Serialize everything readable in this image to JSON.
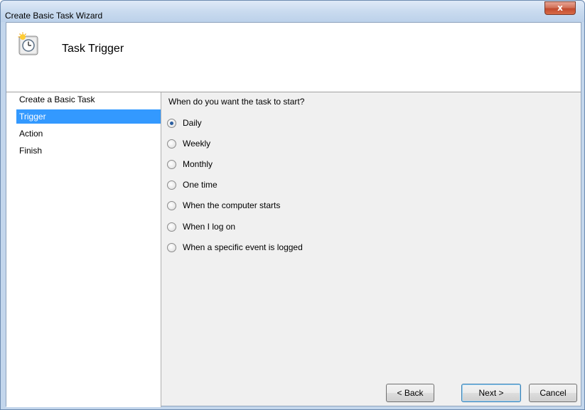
{
  "window": {
    "title": "Create Basic Task Wizard",
    "close_glyph": "x"
  },
  "header": {
    "title": "Task Trigger",
    "icon": "task-scheduler-clock-icon"
  },
  "nav": {
    "items": [
      {
        "label": "Create a Basic Task",
        "selected": false
      },
      {
        "label": "Trigger",
        "selected": true
      },
      {
        "label": "Action",
        "selected": false
      },
      {
        "label": "Finish",
        "selected": false
      }
    ]
  },
  "main": {
    "question": "When do you want the task to start?",
    "options": [
      {
        "label": "Daily",
        "checked": true
      },
      {
        "label": "Weekly",
        "checked": false
      },
      {
        "label": "Monthly",
        "checked": false
      },
      {
        "label": "One time",
        "checked": false
      },
      {
        "label": "When the computer starts",
        "checked": false
      },
      {
        "label": "When I log on",
        "checked": false
      },
      {
        "label": "When a specific event is logged",
        "checked": false
      }
    ]
  },
  "buttons": {
    "back": "< Back",
    "next": "Next >",
    "cancel": "Cancel"
  },
  "colors": {
    "selection": "#3399ff",
    "radio_dot": "#2a5d9f"
  }
}
